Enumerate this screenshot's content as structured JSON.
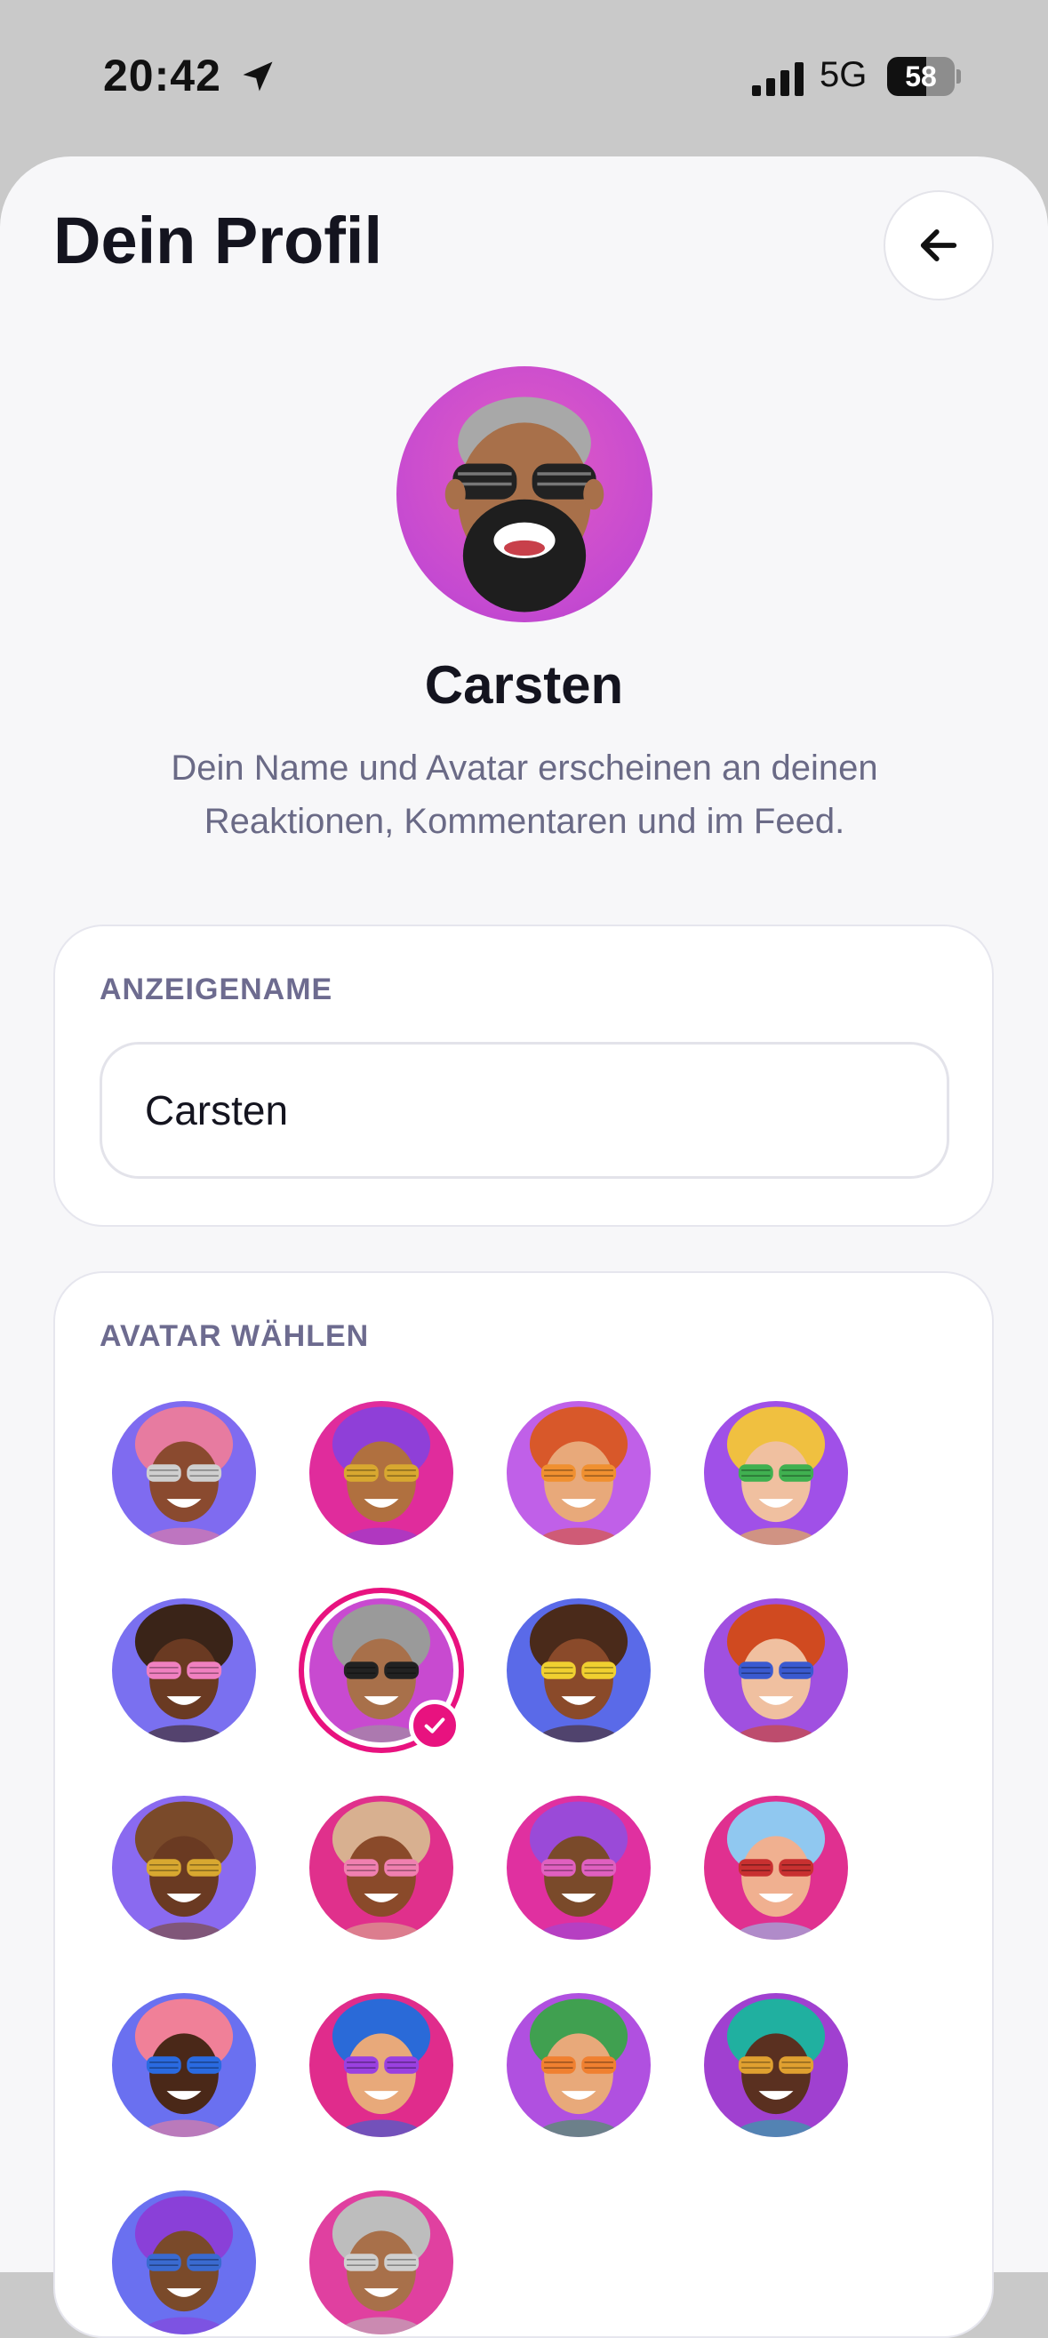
{
  "status_bar": {
    "time": "20:42",
    "network": "5G",
    "battery_percent": "58",
    "battery_level": 0.58
  },
  "header": {
    "title": "Dein Profil",
    "back_icon": "arrow-left-icon"
  },
  "profile": {
    "name": "Carsten",
    "description": "Dein Name und Avatar erscheinen an deinen Reaktionen, Kommentaren und im Feed."
  },
  "display_name_card": {
    "label": "ANZEIGENAME",
    "value": "Carsten"
  },
  "avatar_card": {
    "label": "AVATAR WÄHLEN",
    "selected_index": 5,
    "avatars": [
      {
        "hair": "#e77ba0",
        "bg": "#7f6bf0",
        "skin": "#8a4a2f",
        "glasses": "#cfcfcf"
      },
      {
        "hair": "#8f3fd8",
        "bg": "#e02c9c",
        "skin": "#b0703f",
        "glasses": "#d8a830"
      },
      {
        "hair": "#d8582a",
        "bg": "#c060e8",
        "skin": "#e8a97a",
        "glasses": "#f09030"
      },
      {
        "hair": "#f0c040",
        "bg": "#a050e8",
        "skin": "#f0c0a0",
        "glasses": "#40b050"
      },
      {
        "hair": "#3a2418",
        "bg": "#7a70f0",
        "skin": "#6a3a22",
        "glasses": "#f080c0"
      },
      {
        "hair": "#9a9a9a",
        "bg": "#c84ad0",
        "skin": "#a8704a",
        "glasses": "#222222"
      },
      {
        "hair": "#4a2a1a",
        "bg": "#5a6ae8",
        "skin": "#8a4a2a",
        "glasses": "#f0d030"
      },
      {
        "hair": "#d04a20",
        "bg": "#a050e0",
        "skin": "#f0c0a0",
        "glasses": "#3a5ad0"
      },
      {
        "hair": "#7a4a2a",
        "bg": "#8a6af0",
        "skin": "#6a3a22",
        "glasses": "#d8a830"
      },
      {
        "hair": "#d8b090",
        "bg": "#e0308c",
        "skin": "#8a4a2a",
        "glasses": "#f080b0"
      },
      {
        "hair": "#9a4ad8",
        "bg": "#e030a0",
        "skin": "#7a4a2a",
        "glasses": "#e060c0"
      },
      {
        "hair": "#90c8f0",
        "bg": "#e03090",
        "skin": "#f0b090",
        "glasses": "#c83030"
      },
      {
        "hair": "#f08098",
        "bg": "#6a70f0",
        "skin": "#4a2818",
        "glasses": "#2a6ae0"
      },
      {
        "hair": "#2a6ad8",
        "bg": "#e02c8c",
        "skin": "#e8a97a",
        "glasses": "#9a40e0"
      },
      {
        "hair": "#40a050",
        "bg": "#b050e0",
        "skin": "#e8a97a",
        "glasses": "#f08030"
      },
      {
        "hair": "#20b0a0",
        "bg": "#a040d0",
        "skin": "#5a3020",
        "glasses": "#e0a030"
      },
      {
        "hair": "#8a40d8",
        "bg": "#6a70f0",
        "skin": "#7a4a2a",
        "glasses": "#3a6ad0"
      },
      {
        "hair": "#bdbdbd",
        "bg": "#e040a0",
        "skin": "#a8704a",
        "glasses": "#cfcfcf"
      }
    ]
  }
}
